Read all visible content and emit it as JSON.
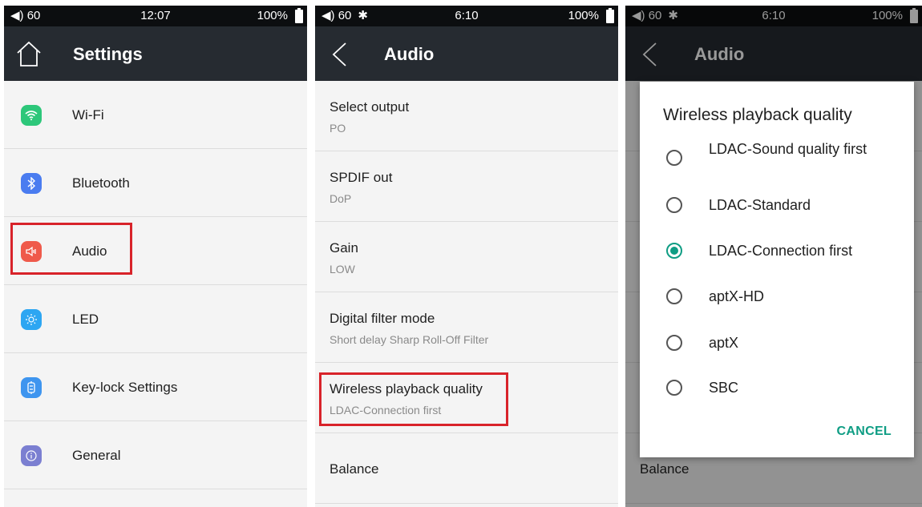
{
  "screen1": {
    "status": {
      "volume": "60",
      "time": "12:07",
      "battery": "100%"
    },
    "title": "Settings",
    "items": [
      {
        "label": "Wi-Fi",
        "icon": "wifi-icon",
        "color": "#2dc77a",
        "glyph": ""
      },
      {
        "label": "Bluetooth",
        "icon": "bluetooth-icon",
        "color": "#4a7cf0",
        "glyph": "✱"
      },
      {
        "label": "Audio",
        "icon": "speaker-icon",
        "color": "#ef5a4b",
        "glyph": "◁"
      },
      {
        "label": "LED",
        "icon": "sun-icon",
        "color": "#2da6f2",
        "glyph": "☼"
      },
      {
        "label": "Key-lock Settings",
        "icon": "lock-icon",
        "color": "#3e95ef",
        "glyph": "⊟"
      },
      {
        "label": "General",
        "icon": "info-icon",
        "color": "#7b7fd1",
        "glyph": "ⓘ"
      }
    ]
  },
  "screen2": {
    "status": {
      "volume": "60",
      "time": "6:10",
      "battery": "100%"
    },
    "title": "Audio",
    "items": [
      {
        "title": "Select output",
        "value": "PO"
      },
      {
        "title": "SPDIF out",
        "value": "DoP"
      },
      {
        "title": "Gain",
        "value": "LOW"
      },
      {
        "title": "Digital filter mode",
        "value": "Short delay Sharp Roll-Off Filter"
      },
      {
        "title": "Wireless playback quality",
        "value": "LDAC-Connection first"
      },
      {
        "title": "Balance"
      }
    ]
  },
  "screen3": {
    "status": {
      "volume": "60",
      "time": "6:10",
      "battery": "100%"
    },
    "title": "Audio",
    "background_item": "Balance",
    "dialog": {
      "title": "Wireless playback quality",
      "options": [
        {
          "label": "LDAC-Sound quality first",
          "selected": false
        },
        {
          "label": "LDAC-Standard",
          "selected": false
        },
        {
          "label": "LDAC-Connection first",
          "selected": true
        },
        {
          "label": "aptX-HD",
          "selected": false
        },
        {
          "label": "aptX",
          "selected": false
        },
        {
          "label": "SBC",
          "selected": false
        }
      ],
      "cancel_label": "CANCEL"
    }
  },
  "colors": {
    "accent": "#0f9d84",
    "highlight": "#d8232a",
    "appbar": "#262b31"
  }
}
